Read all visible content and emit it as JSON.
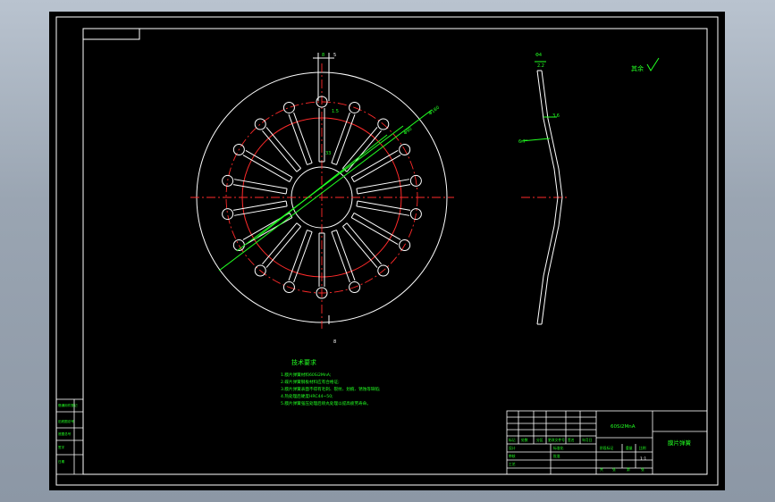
{
  "drawing": {
    "material": "60Si2MnA",
    "part_name": "膜片弹簧",
    "roughness_note": "其余",
    "scale": "1:1",
    "notes_title": "技术要求",
    "notes": [
      "1.膜片弹簧材料60Si2MnA;",
      "2.碟片弹簧钢板材料应有合格证;",
      "3.膜片弹簧表面不得有毛刺、裂纹、划痕、锈蚀等缺陷;",
      "4.热处理后硬度HRC44~50;",
      "5.膜片弹簧强压处理后喷丸处理以提高疲劳寿命。"
    ],
    "dimensions": {
      "slot_width": "8",
      "slot_small": "5",
      "gap": "1.5",
      "depth": "33",
      "dia_1": "Φ90",
      "dia_2": "Φ180",
      "thickness": "Φ4",
      "t1": "2.2",
      "t2": "3.6",
      "angle": "6.7°",
      "bottom": "8"
    },
    "title_block": {
      "labels": [
        "标记",
        "处数",
        "分区",
        "更改文件号",
        "签名",
        "年月日",
        "设计",
        "标准化",
        "审核",
        "工艺",
        "批准",
        "阶段标记",
        "重量",
        "比例",
        "共",
        "张",
        "第",
        "张"
      ],
      "side_labels": [
        "借通用件登记",
        "旧底图总号",
        "底图总号",
        "签字",
        "日期"
      ]
    }
  }
}
